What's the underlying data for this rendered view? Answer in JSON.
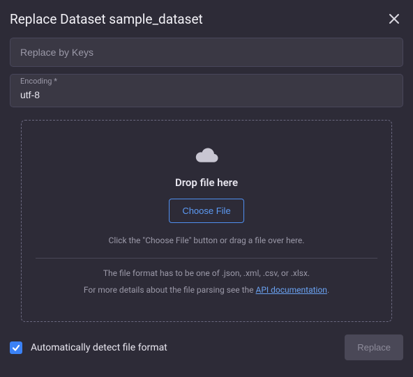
{
  "dialog": {
    "title": "Replace Dataset sample_dataset"
  },
  "fields": {
    "replaceKeys": {
      "placeholder": "Replace by Keys",
      "value": ""
    },
    "encoding": {
      "label": "Encoding *",
      "value": "utf-8"
    }
  },
  "dropzone": {
    "title": "Drop file here",
    "chooseButton": "Choose File",
    "hint": "Click the \"Choose File\" button or drag a file over here.",
    "formatNote": "The file format has to be one of .json, .xml, .csv, or .xlsx.",
    "detailsPrefix": "For more details about the file parsing see the ",
    "detailsLink": "API documentation",
    "detailsSuffix": "."
  },
  "footer": {
    "autoDetectLabel": "Automatically detect file format",
    "autoDetectChecked": true,
    "replaceButton": "Replace"
  }
}
